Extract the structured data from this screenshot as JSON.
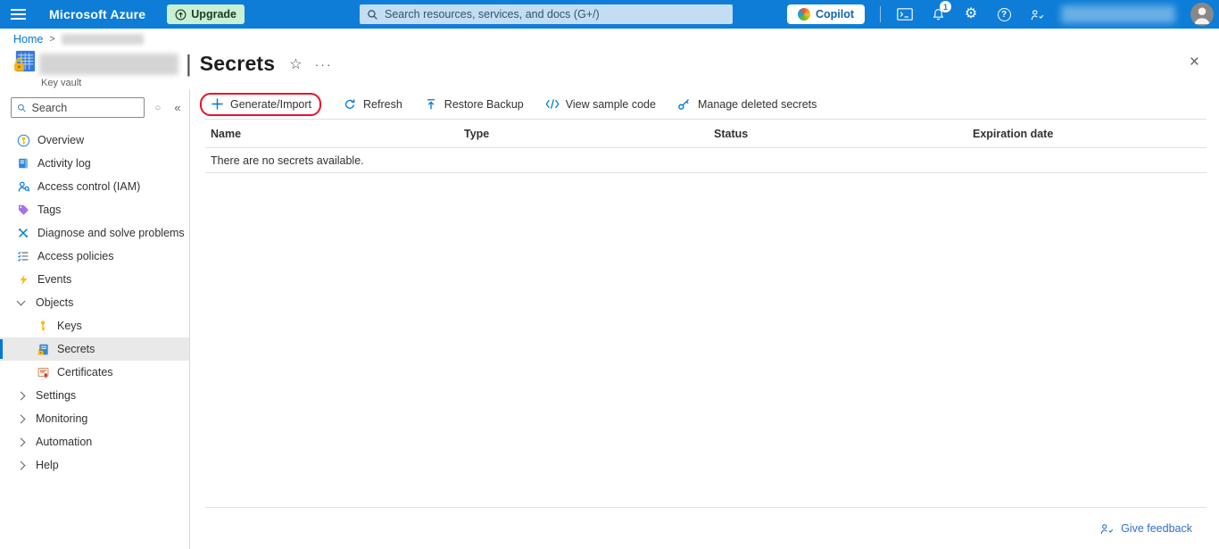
{
  "topbar": {
    "brand": "Microsoft Azure",
    "upgrade_label": "Upgrade",
    "search_placeholder": "Search resources, services, and docs (G+/)",
    "copilot_label": "Copilot",
    "notification_count": "1"
  },
  "breadcrumb": {
    "home": "Home",
    "separator": ">"
  },
  "page": {
    "title": "Secrets",
    "title_separator": "|",
    "resource_type": "Key vault",
    "star_glyph": "☆",
    "more_glyph": "···",
    "close_glyph": "×"
  },
  "sidebar": {
    "search_placeholder": "Search",
    "mini_glyph": "○",
    "collapse_glyph": "«",
    "items": [
      {
        "label": "Overview",
        "icon": "overview-icon",
        "type": "item"
      },
      {
        "label": "Activity log",
        "icon": "activity-log-icon",
        "type": "item"
      },
      {
        "label": "Access control (IAM)",
        "icon": "access-control-icon",
        "type": "item"
      },
      {
        "label": "Tags",
        "icon": "tags-icon",
        "type": "item"
      },
      {
        "label": "Diagnose and solve problems",
        "icon": "diagnose-icon",
        "type": "item"
      },
      {
        "label": "Access policies",
        "icon": "access-policies-icon",
        "type": "item"
      },
      {
        "label": "Events",
        "icon": "events-icon",
        "type": "item"
      },
      {
        "label": "Objects",
        "type": "group",
        "expanded": true
      },
      {
        "label": "Keys",
        "icon": "keys-icon",
        "type": "child"
      },
      {
        "label": "Secrets",
        "icon": "secrets-icon",
        "type": "child",
        "selected": true
      },
      {
        "label": "Certificates",
        "icon": "certificates-icon",
        "type": "child"
      },
      {
        "label": "Settings",
        "type": "group",
        "expanded": false
      },
      {
        "label": "Monitoring",
        "type": "group",
        "expanded": false
      },
      {
        "label": "Automation",
        "type": "group",
        "expanded": false
      },
      {
        "label": "Help",
        "type": "group",
        "expanded": false
      }
    ]
  },
  "toolbar": {
    "items": [
      {
        "label": "Generate/Import",
        "icon": "add-icon",
        "annotated": true
      },
      {
        "label": "Refresh",
        "icon": "refresh-icon"
      },
      {
        "label": "Restore Backup",
        "icon": "restore-backup-icon"
      },
      {
        "label": "View sample code",
        "icon": "code-icon"
      },
      {
        "label": "Manage deleted secrets",
        "icon": "manage-deleted-icon"
      }
    ]
  },
  "table": {
    "columns": [
      "Name",
      "Type",
      "Status",
      "Expiration date"
    ],
    "empty_message": "There are no secrets available."
  },
  "footer": {
    "feedback_label": "Give feedback"
  },
  "colors": {
    "topbar_bg": "#0d7dd8",
    "accent": "#0078d4",
    "annotation_red": "#e8112d",
    "upgrade_bg": "#c9f0d3",
    "search_bg": "#c3def3",
    "selected_bg": "#e9e9e9",
    "link_blue": "#3370cc",
    "text_primary": "#323130",
    "text_secondary": "#605e5c",
    "divider": "#e1e1e1"
  }
}
